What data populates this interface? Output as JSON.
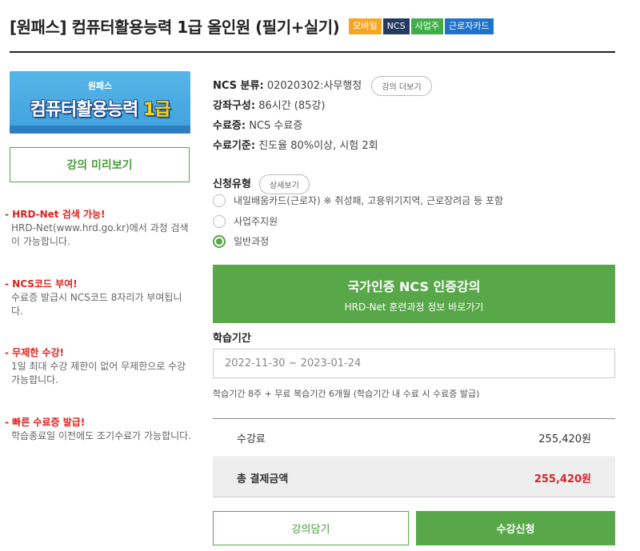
{
  "course": {
    "title": "[원패스] 컴퓨터활용능력 1급 올인원 (필기+실기)",
    "badges": [
      {
        "label": "모바일",
        "color": "#f5a623"
      },
      {
        "label": "NCS",
        "color": "#233b60"
      },
      {
        "label": "사업주",
        "color": "#3fae49"
      },
      {
        "label": "근로자카드",
        "color": "#1f73c9"
      }
    ]
  },
  "banner": {
    "small_text": "원패스",
    "main_text": "컴퓨터활용능력",
    "level_text": "1급"
  },
  "sidebar": {
    "preview_label": "강의 미리보기",
    "features": [
      {
        "head": "- HRD-Net 검색 가능!",
        "body": "HRD-Net(www.hrd.go.kr)에서 과정 검색이 가능합니다."
      },
      {
        "head": "- NCS코드 부여!",
        "body": "수료증 발급시 NCS코드 8자리가 부여됩니다."
      },
      {
        "head": "- 무제한 수강!",
        "body": "1일 최대 수강 제한이 없어 무제한으로 수강 가능합니다."
      },
      {
        "head": "- 빠른 수료증 발급!",
        "body": "학습종료일 이전에도 조기수료가 가능합니다."
      }
    ]
  },
  "info": {
    "ncs_label": "NCS 분류:",
    "ncs_value": "02020302:사무행정",
    "more_label": "강의 더보기",
    "composition_label": "강좌구성:",
    "composition_value": "86시간 (85강)",
    "cert_label": "수료증:",
    "cert_value": "NCS 수료증",
    "criteria_label": "수료기준:",
    "criteria_value": "진도율 80%이상, 시험 2회"
  },
  "apply_type": {
    "label": "신청유형",
    "detail_label": "상세보기",
    "options": [
      {
        "label": "내일배움카드(근로자) ※ 취성패, 고용위기지역, 근로장려금 등 포함",
        "checked": false
      },
      {
        "label": "사업주지원",
        "checked": false
      },
      {
        "label": "일반과정",
        "checked": true
      }
    ]
  },
  "ncs_button": {
    "line1": "국가인증 NCS 인증강의",
    "line2": "HRD-Net 훈련과정 정보 바로가기"
  },
  "period": {
    "label": "학습기간",
    "value": "2022-11-30 ~ 2023-01-24",
    "note": "학습기간 8주 + 무료 복습기간 6개월 (학습기간 내 수료 시 수료증 발급)"
  },
  "price": {
    "fee_label": "수강료",
    "fee_value": "255,420원",
    "total_label": "총 결제금액",
    "total_value": "255,420원"
  },
  "actions": {
    "cart_label": "강의담기",
    "apply_label": "수강신청"
  }
}
